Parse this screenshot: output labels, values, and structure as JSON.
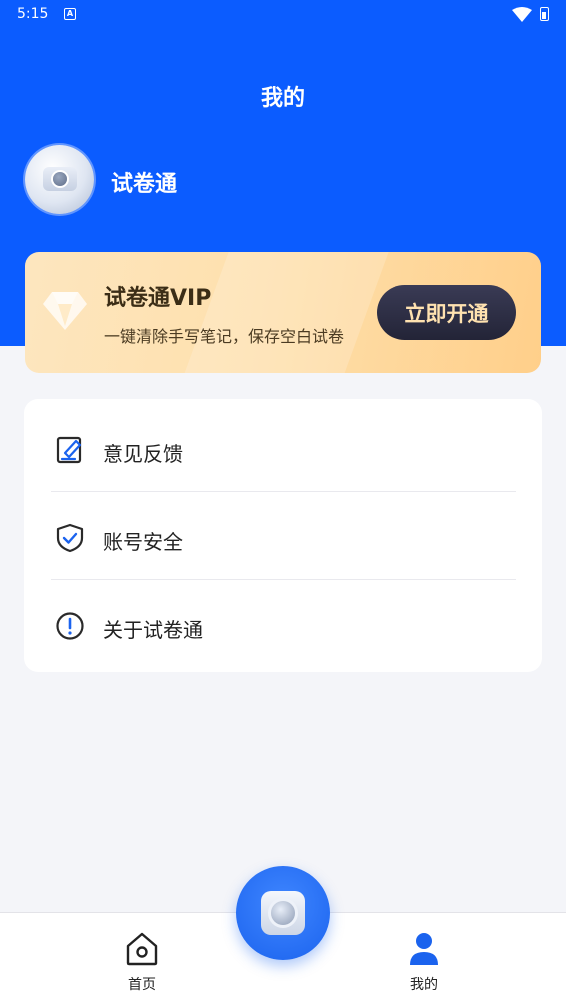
{
  "status_bar": {
    "time": "5:15"
  },
  "header": {
    "title": "我的",
    "username": "试卷通",
    "background_color": "#0b5cff"
  },
  "vip": {
    "title": "试卷通VIP",
    "subtitle": "一键清除手写笔记，保存空白试卷",
    "button_label": "立即开通",
    "icon": "diamond-icon"
  },
  "menu": {
    "items": [
      {
        "label": "意见反馈",
        "icon": "feedback-edit-icon"
      },
      {
        "label": "账号安全",
        "icon": "shield-check-icon"
      },
      {
        "label": "关于试卷通",
        "icon": "info-circle-icon"
      }
    ]
  },
  "bottom_nav": {
    "items": [
      {
        "label": "首页",
        "icon": "home-icon",
        "active": false
      },
      {
        "label": "我的",
        "icon": "user-icon",
        "active": true
      }
    ],
    "center_button_icon": "camera-icon",
    "accent_color": "#1b63ee"
  }
}
